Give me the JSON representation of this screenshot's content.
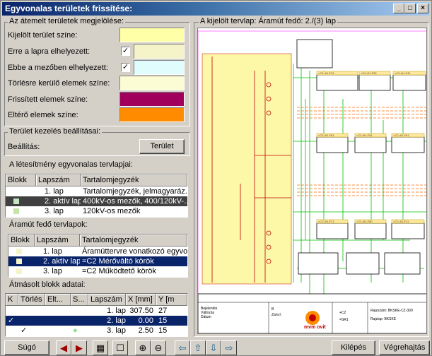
{
  "window": {
    "title": "Egyvonalas területek frissítése:"
  },
  "titlebar_buttons": [
    "_",
    "□",
    "×"
  ],
  "mark_group": {
    "title": "Az átemelt területek megjelölése:",
    "rows": [
      {
        "label": "Kijelölt terület színe:",
        "color": "#ffffa8",
        "checked": null
      },
      {
        "label": "Erre a lapra elhelyezett:",
        "color": "#f4f4c8",
        "checked": true
      },
      {
        "label": "Ebbe a mezőben elhelyezett:",
        "color": "#e0fcfc",
        "checked": true
      },
      {
        "label": "Törlésre kerülő elemek színe:",
        "color": "#fcfcd4",
        "checked": null
      },
      {
        "label": "Frissített elemek színe:",
        "color": "#a0005c",
        "checked": null
      },
      {
        "label": "Eltérő elemek színe:",
        "color": "#ff8c00",
        "checked": null
      }
    ],
    "check_glyph": "✓"
  },
  "area_group": {
    "title": "Terület kezelés beállításai:",
    "setting_label": "Beállítás:",
    "button": "Terület"
  },
  "plans": {
    "title": "A létesítmény egyvonalas tervlapjai:",
    "headers": [
      "Blokk",
      "Lapszám",
      "Tartalomjegyzék"
    ],
    "rows": [
      {
        "mark": "#ffffff",
        "lap": "1. lap",
        "toc": "Tartalomjegyzék, jelmagyaráz...",
        "style": ""
      },
      {
        "mark": "#c4e4c4",
        "lap": "2. aktív lap",
        "toc": "400kV-os mezők, 400/120kV-...",
        "style": "dark"
      },
      {
        "mark": "#c4e4a8",
        "lap": "3. lap",
        "toc": "120kV-os mezők",
        "style": ""
      }
    ]
  },
  "current_plans": {
    "title": "Áramút fedő tervlapok:",
    "headers": [
      "Blokk",
      "Lapszám",
      "Tartalomjegyzék"
    ],
    "rows": [
      {
        "mark": "#f4f4c8",
        "lap": "1. lap",
        "toc": "Áramúttervre vonatkozó egyvo...",
        "style": ""
      },
      {
        "mark": "#f4f4c8",
        "lap": "2. aktív lap",
        "toc": "=C2 Mérőváltó körök",
        "style": "sel"
      },
      {
        "mark": "#f4f4c8",
        "lap": "3. lap",
        "toc": "=C2 Működtető körök",
        "style": ""
      }
    ]
  },
  "copied": {
    "title": "Átmásolt blokk adatai:",
    "headers": [
      "K",
      "Törlés",
      "Elt...",
      "S...",
      "Lapszám",
      "X [mm]",
      "Y [m"
    ],
    "rows": [
      {
        "k": "",
        "del": "",
        "diff": "",
        "s": "",
        "lap": "1. lap",
        "x": "307.50",
        "y": "27",
        "style": ""
      },
      {
        "k": "✓",
        "del": "",
        "diff": "",
        "s": "",
        "lap": "2. lap",
        "x": "0.00",
        "y": "15",
        "style": "sel"
      },
      {
        "k": "",
        "del": "✓",
        "diff": "",
        "s": "●",
        "lap": "3. lap",
        "x": "2.50",
        "y": "15",
        "style": ""
      }
    ]
  },
  "preview": {
    "title": "A kijelölt tervlap: Áramút fedő: 2./(3) lap",
    "title_block": {
      "l1": "Bejelentés",
      "l2": "Változás",
      "l3": "Dátum",
      "v1": "B",
      "v2": "Zahr.f.",
      "c1": "+C2",
      "c2": "=SR1",
      "r1k": "Rajzszám:",
      "r1v": "BKSKE-CZ-300",
      "r2k": "Rajzlap:",
      "r2v": "BKSKE",
      "logo": "mvm ovit"
    },
    "tiny_labels": [
      "=C2-4I1-F31",
      "=C2-4I1-F32",
      "=C2-4I1-F41",
      "=C2-4I1-F51",
      "=C2-4I1-F51",
      "=C2-4I1-F61",
      "=C2-4I1-F71",
      "=C2-4I1-F80",
      "=C2-4I1-F11"
    ]
  },
  "bottom": {
    "help": "Súgó",
    "prev_arrow": "◀",
    "next_arrow": "▶",
    "zoom_in": "⊕",
    "zoom_out": "⊖",
    "left": "⇦",
    "up": "⇧",
    "down": "⇩",
    "right": "⇨",
    "exit": "Kilépés",
    "execute": "Végrehajtás"
  }
}
